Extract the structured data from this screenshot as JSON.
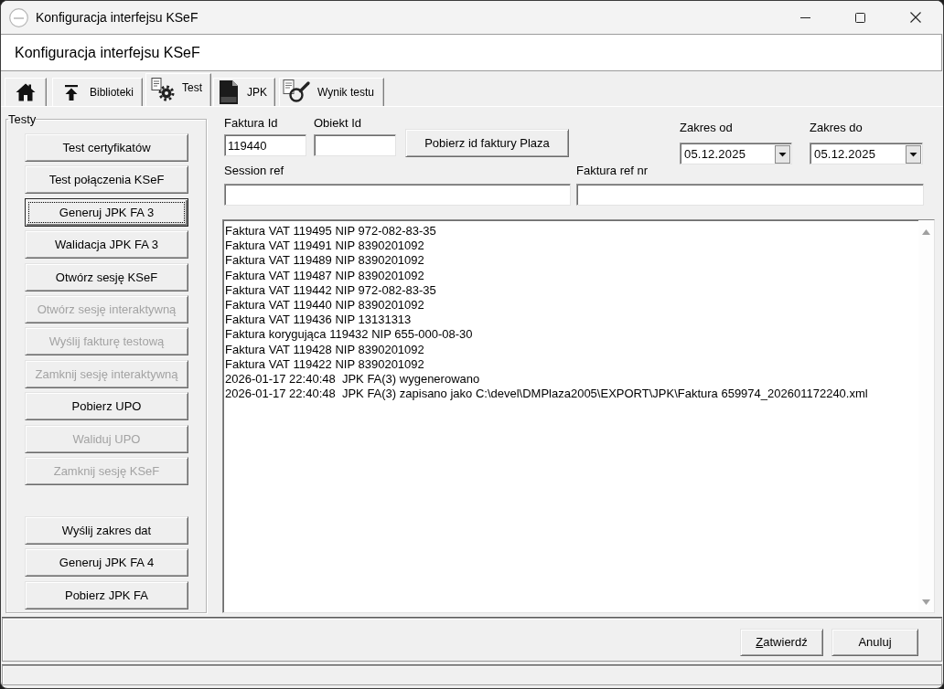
{
  "window": {
    "title": "Konfiguracja interfejsu KSeF"
  },
  "header": {
    "title": "Konfiguracja interfejsu KSeF"
  },
  "tabs": [
    {
      "kind": "home",
      "selected": false
    },
    {
      "kind": "upload",
      "label": "Biblioteki",
      "selected": false
    },
    {
      "kind": "gear-doc",
      "label": "Test",
      "selected": true
    },
    {
      "kind": "xml-file",
      "label": "JPK",
      "selected": false
    },
    {
      "kind": "inspect",
      "label": "Wynik testu",
      "selected": false
    }
  ],
  "tests": {
    "title": "Testy",
    "button_groups": [
      {
        "buttons": [
          {
            "label": "Test certyfikatów",
            "disabled": false,
            "focused": false
          },
          {
            "label": "Test połączenia KSeF",
            "disabled": false,
            "focused": false
          },
          {
            "label": "Generuj JPK FA 3",
            "disabled": false,
            "focused": true
          },
          {
            "label": "Walidacja JPK FA 3",
            "disabled": false,
            "focused": false
          },
          {
            "label": "Otwórz sesję KSeF",
            "disabled": false,
            "focused": false
          },
          {
            "label": "Otwórz sesję interaktywną",
            "disabled": true,
            "focused": false
          },
          {
            "label": "Wyślij fakturę testową",
            "disabled": true,
            "focused": false
          },
          {
            "label": "Zamknij sesję interaktywną",
            "disabled": true,
            "focused": false
          },
          {
            "label": "Pobierz UPO",
            "disabled": false,
            "focused": false
          },
          {
            "label": "Waliduj UPO",
            "disabled": true,
            "focused": false
          },
          {
            "label": "Zamknij sesję KSeF",
            "disabled": true,
            "focused": false
          }
        ]
      },
      {
        "buttons": [
          {
            "label": "Wyślij zakres dat",
            "disabled": false,
            "focused": false
          },
          {
            "label": "Generuj JPK FA 4",
            "disabled": false,
            "focused": false
          },
          {
            "label": "Pobierz JPK FA",
            "disabled": false,
            "focused": false
          }
        ]
      }
    ]
  },
  "form": {
    "faktura_id": {
      "label": "Faktura Id",
      "value": "119440"
    },
    "obiekt_id": {
      "label": "Obiekt Id"
    },
    "fetch_button": {
      "label": "Pobierz id faktury Plaza"
    },
    "zakres_od": {
      "label": "Zakres od",
      "value": "05.12.2025"
    },
    "zakres_do": {
      "label": "Zakres do",
      "value": "05.12.2025"
    },
    "session_ref": {
      "label": "Session ref"
    },
    "faktura_ref_nr": {
      "label": "Faktura ref nr"
    }
  },
  "log": {
    "lines": [
      "Faktura VAT 119495 NIP 972-082-83-35",
      "Faktura VAT 119491 NIP 8390201092",
      "Faktura VAT 119489 NIP 8390201092",
      "Faktura VAT 119487 NIP 8390201092",
      "Faktura VAT 119442 NIP 972-082-83-35",
      "Faktura VAT 119440 NIP 8390201092",
      "Faktura VAT 119436 NIP 13131313",
      "Faktura korygująca 119432 NIP 655-000-08-30",
      "Faktura VAT 119428 NIP 8390201092",
      "Faktura VAT 119422 NIP 8390201092",
      "2026-01-17 22:40:48  JPK FA(3) wygenerowano",
      "2026-01-17 22:40:48  JPK FA(3) zapisano jako C:\\devel\\DMPlaza2005\\EXPORT\\JPK\\Faktura 659974_202601172240.xml"
    ]
  },
  "footer_buttons": [
    {
      "label": "Zatwierdź",
      "mnemonic": true
    },
    {
      "label": "Anuluj",
      "mnemonic": false
    }
  ]
}
